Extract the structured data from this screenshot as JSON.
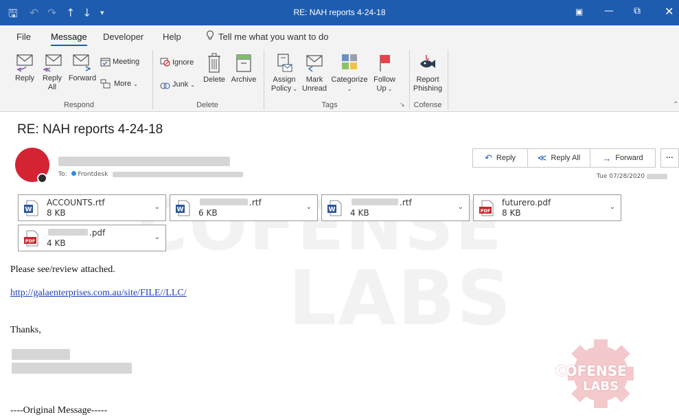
{
  "window": {
    "title": "RE: NAH reports 4-24-18"
  },
  "menu": [
    "File",
    "Message",
    "Developer",
    "Help"
  ],
  "tell_me": "Tell me what you want to do",
  "ribbon": {
    "respond": {
      "label": "Respond",
      "reply": "Reply",
      "reply_all": [
        "Reply",
        "All"
      ],
      "forward": "Forward",
      "meeting": "Meeting",
      "more": "More"
    },
    "delete": {
      "label": "Delete",
      "ignore": "Ignore",
      "junk": "Junk",
      "delete": "Delete",
      "archive": "Archive"
    },
    "tags": {
      "label": "Tags",
      "assign_policy": [
        "Assign",
        "Policy"
      ],
      "mark_unread": [
        "Mark",
        "Unread"
      ],
      "categorize": "Categorize",
      "follow_up": [
        "Follow",
        "Up"
      ]
    },
    "cofense": {
      "label": "Cofense",
      "report_phishing": [
        "Report",
        "Phishing"
      ]
    }
  },
  "message": {
    "subject": "RE: NAH reports 4-24-18",
    "to_label": "To:",
    "to_name": "Frontdesk",
    "date": "Tue 07/28/2020",
    "actions": {
      "reply": "Reply",
      "reply_all": "Reply All",
      "forward": "Forward",
      "more": "···"
    },
    "attachments": [
      {
        "name": "ACCOUNTS.rtf",
        "size": "8 KB",
        "type": "word"
      },
      {
        "name": ".rtf",
        "size": "6 KB",
        "type": "word"
      },
      {
        "name": ".rtf",
        "size": "4 KB",
        "type": "word"
      },
      {
        "name": "futurero.pdf",
        "size": "8 KB",
        "type": "pdf"
      },
      {
        "name": ".pdf",
        "size": "4 KB",
        "type": "pdf"
      }
    ],
    "body": {
      "line1": "Please see/review attached.",
      "link": "http://galaenterprises.com.au/site/FILE//LLC/",
      "thanks": "Thanks,",
      "original": "----Original Message-----"
    }
  },
  "watermark": {
    "logo_line1": "COFENSE",
    "logo_line2": "LABS"
  },
  "colors": {
    "titlebar": "#1e5cb0",
    "avatar": "#d42333",
    "link": "#1f3fb8",
    "pdf": "#c8262c",
    "word": "#2b579a"
  }
}
